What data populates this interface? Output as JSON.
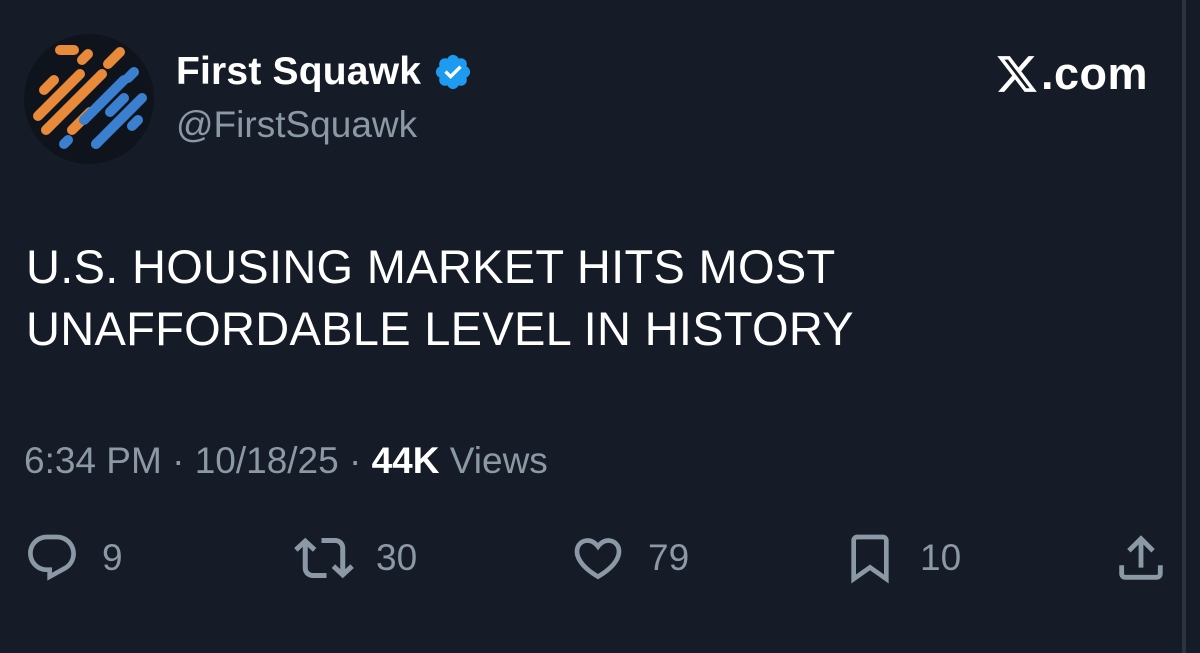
{
  "tweet": {
    "author": {
      "display_name": "First Squawk",
      "handle": "@FirstSquawk",
      "verified": true,
      "avatar_icon": "first-squawk-logo"
    },
    "brand": {
      "logo_text": ".com",
      "logo_icon": "x-logo"
    },
    "text_lines": [
      "U.S. HOUSING MARKET HITS MOST",
      "UNAFFORDABLE LEVEL IN HISTORY"
    ],
    "meta": {
      "time": "6:34 PM",
      "separator": " · ",
      "date": "10/18/25",
      "views_count": "44K",
      "views_label": " Views"
    },
    "actions": {
      "replies": {
        "icon": "reply-icon",
        "count": "9"
      },
      "reposts": {
        "icon": "repost-icon",
        "count": "30"
      },
      "likes": {
        "icon": "heart-icon",
        "count": "79"
      },
      "bookmarks": {
        "icon": "bookmark-icon",
        "count": "10"
      },
      "share": {
        "icon": "share-icon"
      }
    }
  },
  "colors": {
    "background": "#161c27",
    "text_primary": "#ffffff",
    "text_secondary": "#8b98a5",
    "verified_blue": "#1d9bf0",
    "avatar_orange": "#e88a3a",
    "avatar_blue": "#3a7fd0"
  }
}
